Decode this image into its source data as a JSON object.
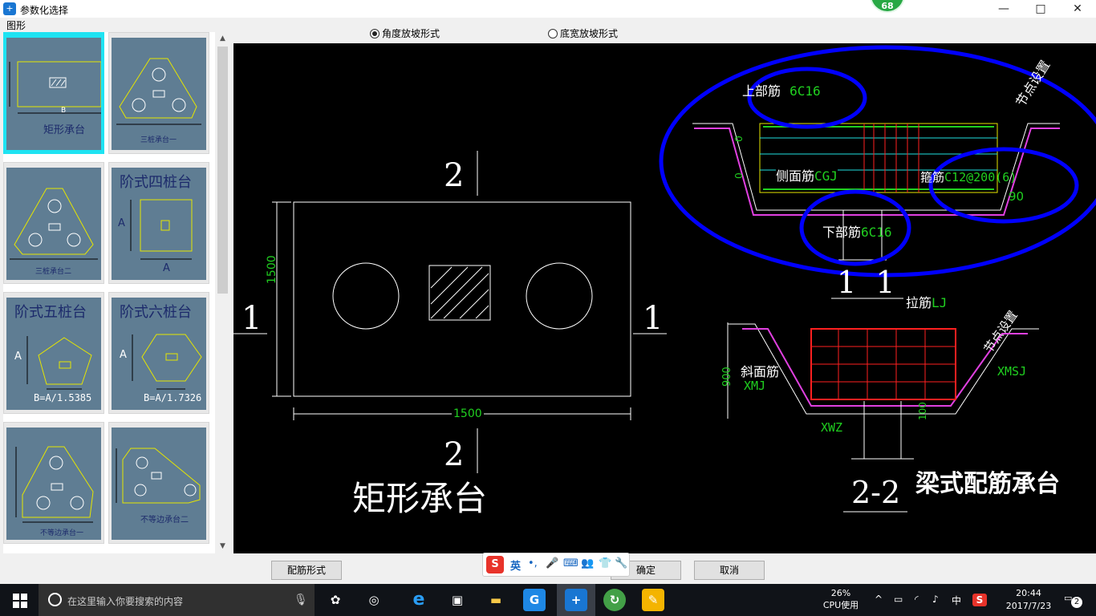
{
  "window": {
    "title": "参数化选择",
    "app_icon_glyph": "+",
    "minimize": "—",
    "maximize": "□",
    "close": "✕",
    "overlay_badge": "68"
  },
  "left_panel": {
    "label": "图形",
    "thumbnails": [
      {
        "name": "矩形承台",
        "caption": "矩形承台",
        "small_caption": "B",
        "selected": true
      },
      {
        "name": "三桩承台一",
        "caption": "三桩承台一",
        "selected": false
      },
      {
        "name": "三桩承台二",
        "caption": "三桩承台二",
        "selected": false
      },
      {
        "name": "阶式四桩台",
        "caption": "阶式四桩台",
        "dim_a": "A",
        "selected": false
      },
      {
        "name": "阶式五桩台",
        "caption": "阶式五桩台",
        "formula": "B=A/1.5385",
        "dim_a": "A",
        "selected": false
      },
      {
        "name": "阶式六桩台",
        "caption": "阶式六桩台",
        "formula": "B=A/1.7326",
        "dim_a": "A",
        "selected": false
      },
      {
        "name": "不等边承台一",
        "caption": "不等边承台一",
        "selected": false
      },
      {
        "name": "不等边承台二",
        "caption": "不等边承台二",
        "selected": false
      }
    ]
  },
  "slope_options": {
    "options": [
      {
        "label": "角度放坡形式",
        "checked": true
      },
      {
        "label": "底宽放坡形式",
        "checked": false
      }
    ]
  },
  "drawing": {
    "plan_title": "矩形承台",
    "dim_width": "1500",
    "dim_height": "1500",
    "section_mark_1": "1",
    "section_mark_2": "2",
    "section_11": {
      "title": "1  1",
      "top_bar_label": "上部筋",
      "top_bar_value": "6C16",
      "side_bar_label": "侧面筋",
      "side_bar_value": "CGJ",
      "stirrup_label": "箍筋",
      "stirrup_value": "C12@200(6)",
      "bottom_bar_label": "下部筋",
      "bottom_bar_value": "6C16",
      "node_setting": "节点设置",
      "angle": "90",
      "zero_1": "0",
      "zero_2": "0"
    },
    "section_22": {
      "title": "2-2",
      "tie_label": "拉筋",
      "tie_value": "LJ",
      "slope_bar_label": "斜面筋",
      "slope_bar_value": "XMJ",
      "xmsj": "XMSJ",
      "xwz": "XWZ",
      "height": "900",
      "bottom_dim": "100",
      "node_setting": "节点设置"
    },
    "beam_title": "梁式配筋承台"
  },
  "buttons": {
    "reinforcement": "配筋形式",
    "ok": "确定",
    "cancel": "取消"
  },
  "ime": {
    "logo": "S",
    "lang": "英",
    "punct": "•,",
    "mic": "🎤",
    "keyboard": "⌨",
    "user": "👥",
    "skin": "👕",
    "tool": "🔧"
  },
  "taskbar": {
    "search_placeholder": "在这里输入你要搜索的内容",
    "cpu_percent": "26%",
    "cpu_label": "CPU使用",
    "ime_lang": "中",
    "time": "20:44",
    "date": "2017/7/23",
    "notification_count": "2"
  },
  "colors": {
    "canvas_bg": "#000000",
    "highlight_blue": "#0000ff",
    "green_text": "#00c000",
    "red_bar": "#ff2020",
    "magenta": "#e040e0",
    "yellow_outline": "#e6e600",
    "selection_cyan": "#1ee3f2",
    "thumb_bg": "#5f7d93"
  }
}
